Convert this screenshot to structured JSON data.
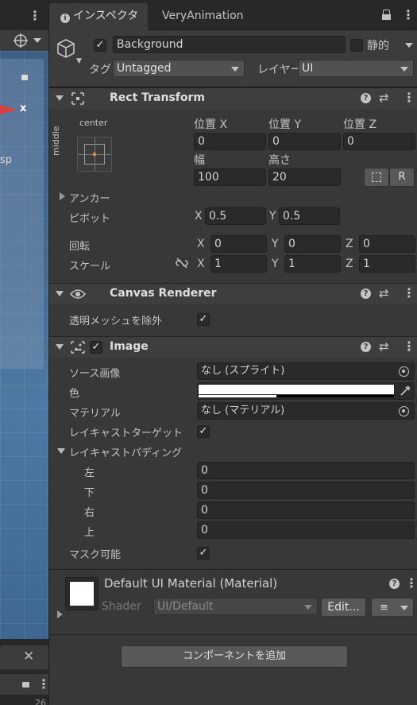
{
  "scene": {
    "side_label": "sp",
    "axis_label": "x",
    "bottom_count": "26"
  },
  "tabs": {
    "inspector": "インスペクター",
    "other": "VeryAnimation"
  },
  "header": {
    "name": "Background",
    "static_label": "静的",
    "tag_label": "タグ",
    "tag_value": "Untagged",
    "layer_label": "レイヤー",
    "layer_value": "UI"
  },
  "rect_transform": {
    "title": "Rect Transform",
    "anchor_h": "center",
    "anchor_v": "middle",
    "pos_x_label": "位置 X",
    "pos_y_label": "位置 Y",
    "pos_z_label": "位置 Z",
    "pos_x": "0",
    "pos_y": "0",
    "pos_z": "0",
    "width_label": "幅",
    "height_label": "高さ",
    "width": "100",
    "height": "20",
    "r_button": "R",
    "anchors_label": "アンカー",
    "pivot_label": "ピボット",
    "pivot_x_label": "X",
    "pivot_y_label": "Y",
    "pivot_x": "0.5",
    "pivot_y": "0.5",
    "rotation_label": "回転",
    "rot_x": "0",
    "rot_y": "0",
    "rot_z": "0",
    "scale_label": "スケール",
    "scale_x": "1",
    "scale_y": "1",
    "scale_z": "1",
    "axis_x": "X",
    "axis_y": "Y",
    "axis_z": "Z"
  },
  "canvas_renderer": {
    "title": "Canvas Renderer",
    "cull_label": "透明メッシュを除外"
  },
  "image": {
    "title": "Image",
    "source_label": "ソース画像",
    "source_value": "なし (スプライト)",
    "color_label": "色",
    "material_label": "マテリアル",
    "material_value": "なし (マテリアル)",
    "raycast_target_label": "レイキャストターゲット",
    "raycast_padding_label": "レイキャストパディング",
    "left_label": "左",
    "bottom_label": "下",
    "right_label": "右",
    "top_label": "上",
    "left": "0",
    "bottom": "0",
    "right": "0",
    "top": "0",
    "maskable_label": "マスク可能"
  },
  "material": {
    "title": "Default UI Material (Material)",
    "shader_label": "Shader",
    "shader_value": "UI/Default",
    "edit_label": "Edit..."
  },
  "add_component_label": "コンポーネントを追加",
  "colors": {
    "background": "#383838",
    "field": "#2a2a2a",
    "header": "#3e3e3e"
  }
}
